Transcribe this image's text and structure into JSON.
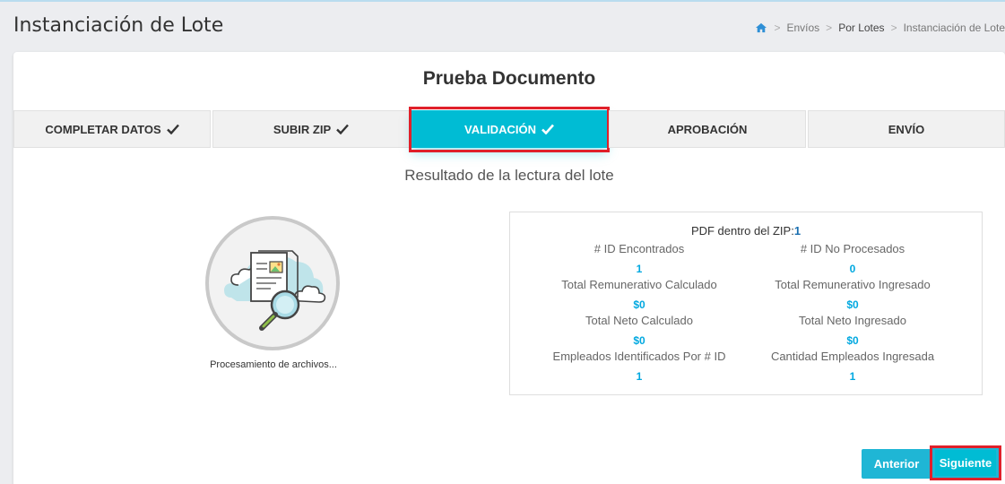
{
  "page": {
    "title": "Instanciación de Lote"
  },
  "breadcrumb": {
    "items": [
      "Envíos",
      "Por Lotes",
      "Instanciación de Lote"
    ]
  },
  "card": {
    "title": "Prueba Documento",
    "steps": [
      {
        "label": "Completar Datos",
        "done": true
      },
      {
        "label": "Subir ZIP",
        "done": true
      },
      {
        "label": "Validación",
        "done": true,
        "active": true
      },
      {
        "label": "Aprobación",
        "done": false
      },
      {
        "label": "Envío",
        "done": false
      }
    ],
    "subtitle": "Resultado de la lectura del lote",
    "process_label": "Procesamiento de archivos..."
  },
  "results": {
    "pdf_label": "PDF dentro del ZIP:",
    "pdf_count": "1",
    "left": [
      {
        "label": "# ID Encontrados",
        "value": "1"
      },
      {
        "label": "Total Remunerativo Calculado",
        "value": "$0"
      },
      {
        "label": "Total Neto Calculado",
        "value": "$0"
      },
      {
        "label": "Empleados Identificados Por # ID",
        "value": "1"
      }
    ],
    "right": [
      {
        "label": "# ID No Procesados",
        "value": "0"
      },
      {
        "label": "Total Remunerativo Ingresado",
        "value": "$0"
      },
      {
        "label": "Total Neto Ingresado",
        "value": "$0"
      },
      {
        "label": "Cantidad Empleados Ingresada",
        "value": "1"
      }
    ]
  },
  "buttons": {
    "prev": "Anterior",
    "next": "Siguiente"
  },
  "colors": {
    "accent": "#00bcd4",
    "value": "#00a8e0",
    "highlight": "#e0202a"
  },
  "icons": {
    "home": "home-icon",
    "check": "check-icon",
    "illustration": "document-search-icon"
  }
}
